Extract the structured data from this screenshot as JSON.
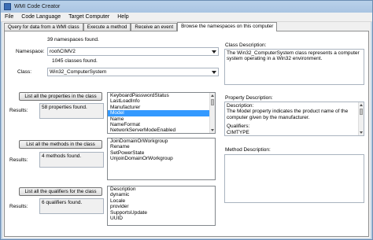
{
  "window": {
    "title": "WMI Code Creator"
  },
  "menu": [
    "File",
    "Code Language",
    "Target Computer",
    "Help"
  ],
  "tabs": [
    "Query for data from a WMI class",
    "Execute a method",
    "Receive an event",
    "Browse the namespaces on this computer"
  ],
  "browse": {
    "namespaces_found": "39 namespaces found.",
    "namespace_label": "Namespace:",
    "namespace_value": "root\\CIMV2",
    "classes_found": "1045 classes found.",
    "class_label": "Class:",
    "class_value": "Win32_ComputerSystem",
    "results_label": "Results:",
    "properties": {
      "button": "List all the properties in the class",
      "result": "58 properties found.",
      "items": [
        "KeyboardPasswordStatus",
        "LastLoadInfo",
        "Manufacturer",
        "Model",
        "Name",
        "NameFormat",
        "NetworkServerModeEnabled"
      ],
      "selected": "Model"
    },
    "methods": {
      "button": "List all the methods in the class",
      "result": "4 methods found.",
      "items": [
        "JoinDomainOrWorkgroup",
        "Rename",
        "SetPowerState",
        "UnjoinDomainOrWorkgroup"
      ]
    },
    "qualifiers": {
      "button": "List all the qualifiers for the class",
      "result": "6 qualifiers found.",
      "items": [
        "Description",
        "dynamic",
        "Locale",
        "provider",
        "SupportsUpdate",
        "UUID"
      ]
    },
    "class_description": {
      "label": "Class Description:",
      "text": "The Win32_ComputerSystem class represents a computer system operating in a Win32 environment."
    },
    "property_description": {
      "label": "Property Description:",
      "lines": [
        "Description:",
        "The Model property indicates the product name of the computer given by the manufacturer.",
        "",
        "Qualifiers:",
        "CIMTYPE"
      ]
    },
    "method_description": {
      "label": "Method Description:"
    }
  },
  "colors": {
    "selection": "#3399ff",
    "window_frame": "#b8cde2"
  }
}
